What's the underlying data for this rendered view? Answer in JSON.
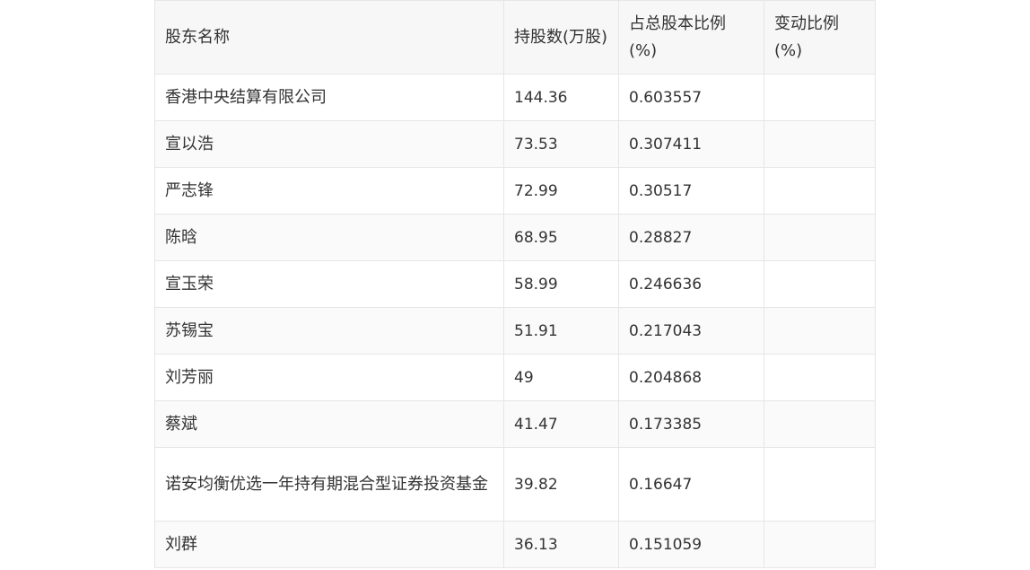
{
  "table": {
    "headers": [
      "股东名称",
      "持股数(万股)",
      "占总股本比例(%)",
      "变动比例(%)"
    ],
    "rows": [
      {
        "name": "香港中央结算有限公司",
        "shares": "144.36",
        "ratio": "0.603557",
        "change": ""
      },
      {
        "name": "宣以浩",
        "shares": "73.53",
        "ratio": "0.307411",
        "change": ""
      },
      {
        "name": "严志锋",
        "shares": "72.99",
        "ratio": "0.30517",
        "change": ""
      },
      {
        "name": "陈晗",
        "shares": "68.95",
        "ratio": "0.28827",
        "change": ""
      },
      {
        "name": "宣玉荣",
        "shares": "58.99",
        "ratio": "0.246636",
        "change": ""
      },
      {
        "name": "苏锡宝",
        "shares": "51.91",
        "ratio": "0.217043",
        "change": ""
      },
      {
        "name": "刘芳丽",
        "shares": "49",
        "ratio": "0.204868",
        "change": ""
      },
      {
        "name": "蔡斌",
        "shares": "41.47",
        "ratio": "0.173385",
        "change": ""
      },
      {
        "name": "诺安均衡优选一年持有期混合型证券投资基金",
        "shares": "39.82",
        "ratio": "0.16647",
        "change": ""
      },
      {
        "name": "刘群",
        "shares": "36.13",
        "ratio": "0.151059",
        "change": ""
      }
    ]
  }
}
